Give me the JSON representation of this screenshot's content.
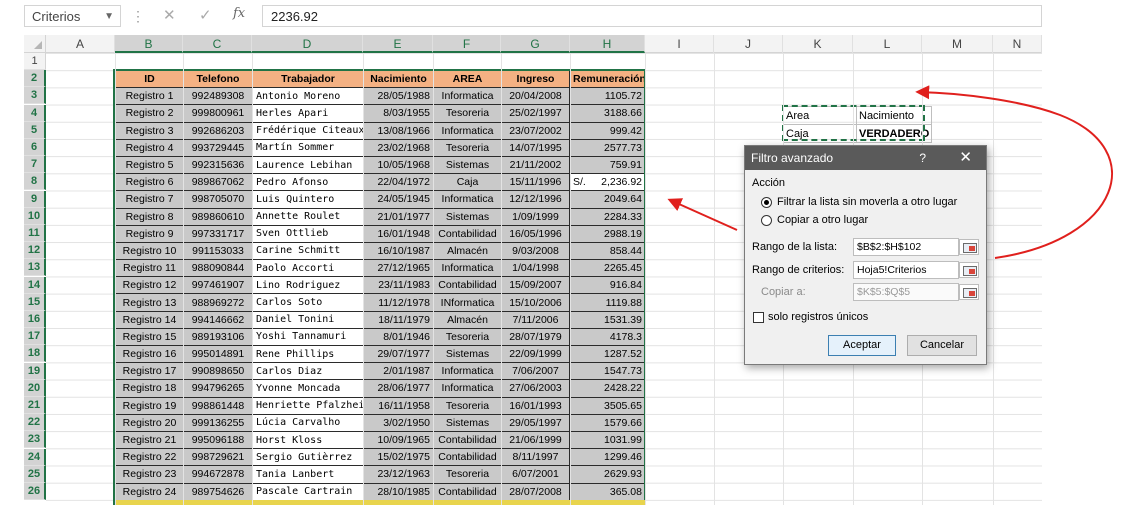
{
  "formula_bar": {
    "name_box": "Criterios",
    "formula": "2236.92",
    "fx_label": "fx"
  },
  "columns": [
    "A",
    "B",
    "C",
    "D",
    "E",
    "F",
    "G",
    "H",
    "I",
    "J",
    "K",
    "L",
    "M",
    "N"
  ],
  "rows": [
    "1",
    "2",
    "3",
    "4",
    "5",
    "6",
    "7",
    "8",
    "9",
    "10",
    "11",
    "12",
    "13",
    "14",
    "15",
    "16",
    "17",
    "18",
    "19",
    "20",
    "21",
    "22",
    "23",
    "24",
    "25",
    "26"
  ],
  "table": {
    "headers": [
      "ID",
      "Telefono",
      "Trabajador",
      "Nacimiento",
      "AREA",
      "Ingreso",
      "Remuneración"
    ],
    "currency_symbol": "S/.",
    "rows": [
      [
        "Registro 1",
        "992489308",
        "Antonio Moreno",
        "28/05/1988",
        "Informatica",
        "20/04/2008",
        "1105.72"
      ],
      [
        "Registro 2",
        "999800961",
        "Herles Apari",
        "8/03/1955",
        "Tesoreria",
        "25/02/1997",
        "3188.66"
      ],
      [
        "Registro 3",
        "992686203",
        "Frédérique Citeaux",
        "13/08/1966",
        "Informatica",
        "23/07/2002",
        "999.42"
      ],
      [
        "Registro 4",
        "993729445",
        "Martín Sommer",
        "23/02/1968",
        "Tesoreria",
        "14/07/1995",
        "2577.73"
      ],
      [
        "Registro 5",
        "992315636",
        "Laurence Lebihan",
        "10/05/1968",
        "Sistemas",
        "21/11/2002",
        "759.91"
      ],
      [
        "Registro 6",
        "989867062",
        "Pedro Afonso",
        "22/04/1972",
        "Caja",
        "15/11/1996",
        "2,236.92"
      ],
      [
        "Registro 7",
        "998705070",
        "Luis Quintero",
        "24/05/1945",
        "Informatica",
        "12/12/1996",
        "2049.64"
      ],
      [
        "Registro 8",
        "989860610",
        "Annette Roulet",
        "21/01/1977",
        "Sistemas",
        "1/09/1999",
        "2284.33"
      ],
      [
        "Registro 9",
        "997331717",
        "Sven Ottlieb",
        "16/01/1948",
        "Contabilidad",
        "16/05/1996",
        "2988.19"
      ],
      [
        "Registro 10",
        "991153033",
        "Carine Schmitt",
        "16/10/1987",
        "Almacén",
        "9/03/2008",
        "858.44"
      ],
      [
        "Registro 11",
        "988090844",
        "Paolo Accorti",
        "27/12/1965",
        "Informatica",
        "1/04/1998",
        "2265.45"
      ],
      [
        "Registro 12",
        "997461907",
        "Lino Rodriguez",
        "23/11/1983",
        "Contabilidad",
        "15/09/2007",
        "916.84"
      ],
      [
        "Registro 13",
        "988969272",
        "Carlos Soto",
        "11/12/1978",
        "INformatica",
        "15/10/2006",
        "1119.88"
      ],
      [
        "Registro 14",
        "994146662",
        "Daniel Tonini",
        "18/11/1979",
        "Almacén",
        "7/11/2006",
        "1531.39"
      ],
      [
        "Registro 15",
        "989193106",
        "Yoshi Tannamuri",
        "8/01/1946",
        "Tesoreria",
        "28/07/1979",
        "4178.3"
      ],
      [
        "Registro 16",
        "995014891",
        "Rene Phillips",
        "29/07/1977",
        "Sistemas",
        "22/09/1999",
        "1287.52"
      ],
      [
        "Registro 17",
        "990898650",
        "Carlos Diaz",
        "2/01/1987",
        "Informatica",
        "7/06/2007",
        "1547.73"
      ],
      [
        "Registro 18",
        "994796265",
        "Yvonne Moncada",
        "28/06/1977",
        "Informatica",
        "27/06/2003",
        "2428.22"
      ],
      [
        "Registro 19",
        "998861448",
        "Henriette Pfalzheim",
        "16/11/1958",
        "Tesoreria",
        "16/01/1993",
        "3505.65"
      ],
      [
        "Registro 20",
        "999136255",
        "Lúcia Carvalho",
        "3/02/1950",
        "Sistemas",
        "29/05/1997",
        "1579.66"
      ],
      [
        "Registro 21",
        "995096188",
        "Horst Kloss",
        "10/09/1965",
        "Contabilidad",
        "21/06/1999",
        "1031.99"
      ],
      [
        "Registro 22",
        "998729621",
        "Sergio Gutièrrez",
        "15/02/1975",
        "Contabilidad",
        "8/11/1997",
        "1299.46"
      ],
      [
        "Registro 23",
        "994672878",
        "Tania Lanbert",
        "23/12/1963",
        "Tesoreria",
        "6/07/2001",
        "2629.93"
      ],
      [
        "Registro 24",
        "989754626",
        "Pascale Cartrain",
        "28/10/1985",
        "Contabilidad",
        "28/07/2008",
        "365.08"
      ]
    ]
  },
  "criteria": {
    "h1": "Area",
    "h2": "Nacimiento",
    "v1": "Caja",
    "v2": "VERDADERO"
  },
  "dialog": {
    "title": "Filtro avanzado",
    "help": "?",
    "close": "✕",
    "section": "Acción",
    "option1": "Filtrar la lista sin moverla a otro lugar",
    "option2": "Copiar a otro lugar",
    "list_range_label": "Rango de la lista:",
    "list_range_value": "$B$2:$H$102",
    "criteria_range_label": "Rango de criterios:",
    "criteria_range_value": "Hoja5!Criterios",
    "copy_to_label": "Copiar a:",
    "copy_to_value": "$K$5:$Q$5",
    "unique_label": "solo registros únicos",
    "ok": "Aceptar",
    "cancel": "Cancelar"
  },
  "colors": {
    "header_fill": "#f4b183",
    "row_fill": "#c9c9c9",
    "excel_green": "#217346",
    "arrow_red": "#e0201d",
    "dialog_title": "#5a5a5a"
  }
}
